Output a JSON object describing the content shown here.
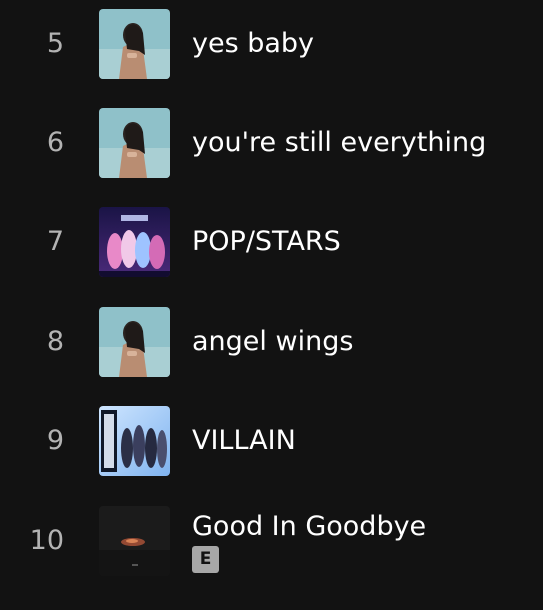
{
  "tracks": [
    {
      "index": "5",
      "title": "yes baby",
      "artwork": "portrait-cover-art"
    },
    {
      "index": "6",
      "title": "you're still everything",
      "artwork": "portrait-cover-art"
    },
    {
      "index": "7",
      "title": "POP/STARS",
      "artwork": "kda-group-cover-art"
    },
    {
      "index": "8",
      "title": "angel wings",
      "artwork": "portrait-cover-art"
    },
    {
      "index": "9",
      "title": "VILLAIN",
      "artwork": "all-out-cover-art"
    },
    {
      "index": "10",
      "title": "Good In Goodbye",
      "artwork": "dark-fire-cover-art",
      "explicit_badge": "E"
    }
  ]
}
